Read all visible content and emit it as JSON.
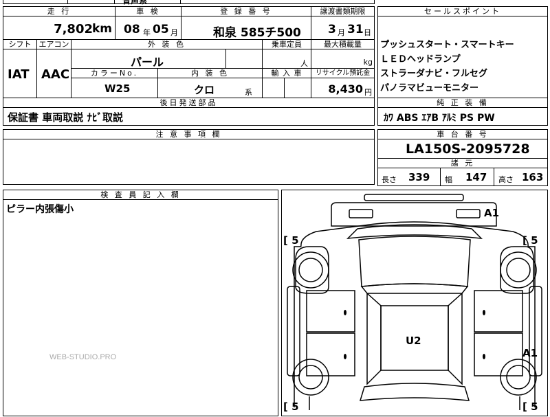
{
  "sheet": {
    "top_remnant": "音声系",
    "mileage": {
      "header": "走 行",
      "value": "7,802",
      "unit": "km"
    },
    "inspection": {
      "header": "車 検",
      "year": "08",
      "year_unit": "年",
      "month": "05",
      "month_unit": "月"
    },
    "registration": {
      "header": "登 録 番 号",
      "value": "和泉 585チ500"
    },
    "transfer_deadline": {
      "header": "譲渡書類期限",
      "month": "3",
      "month_unit": "月",
      "day": "31",
      "day_unit": "日"
    },
    "shift": {
      "header": "シフト",
      "value": "IAT"
    },
    "aircon": {
      "header": "エアコン",
      "value": "AAC"
    },
    "exterior_color": {
      "header": "外 装 色",
      "value": "パール"
    },
    "capacity": {
      "header": "乗車定員",
      "unit": "人"
    },
    "max_load": {
      "header": "最大積載量",
      "unit": "kg"
    },
    "color_no": {
      "header": "カラーNo.",
      "value": "W25"
    },
    "interior_color": {
      "header": "内 装 色",
      "value": "クロ",
      "suffix": "系"
    },
    "import": {
      "header": "輸 入 車"
    },
    "recycle_fee": {
      "header": "リサイクル預託金",
      "value": "8,430",
      "unit": "円"
    },
    "later_parts": {
      "header": "後日発送部品",
      "value": "保証書 車両取説 ﾅﾋﾞ取説"
    },
    "notes": {
      "header": "注 意 事 項 欄"
    },
    "inspector": {
      "header": "検 査 員 記 入 欄",
      "value": "ピラー内張傷小"
    },
    "sales_points": {
      "header": "セールスポイント",
      "items": [
        "プッシュスタート・スマートキー",
        "ＬＥＤヘッドランプ",
        "ストラーダナビ・フルセグ",
        "パノラマビューモニター"
      ]
    },
    "standard_equipment": {
      "header": "純 正 装 備",
      "value": "ｶﾜ ABS ｴｱB ｱﾙﾐ PS PW"
    },
    "chassis": {
      "header": "車 台 番 号",
      "value": "LA150S-2095728"
    },
    "dimensions": {
      "header": "諸 元",
      "length_label": "長さ",
      "length": "339",
      "width_label": "幅",
      "width": "147",
      "height_label": "高さ",
      "height": "163"
    },
    "diagram": {
      "marks": {
        "front_right": "A1",
        "center": "U2",
        "rear_right": "A1"
      },
      "tire_label": "[ 5 ]",
      "tire_labels": [
        "[ 5",
        "[ 5",
        "[ 5",
        "[ 5"
      ]
    }
  },
  "watermark": "WEB-STUDIO.PRO"
}
